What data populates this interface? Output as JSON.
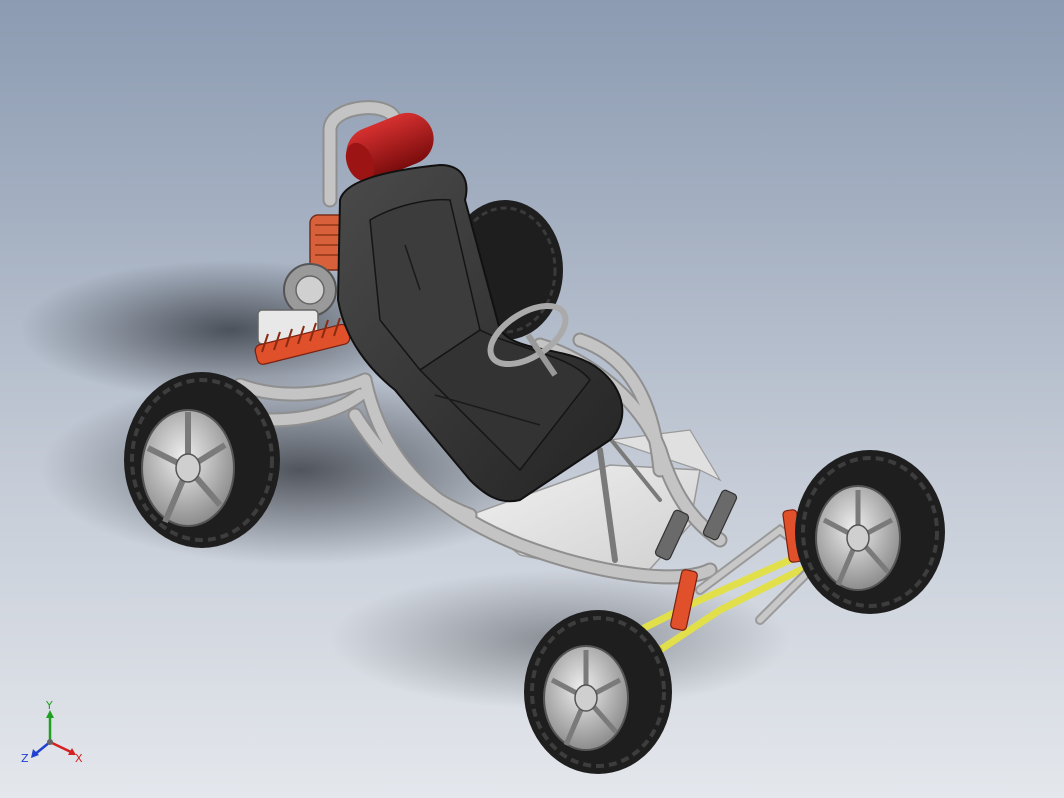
{
  "viewport": {
    "background_top": "#8c9bb2",
    "background_bottom": "#e4e7ec"
  },
  "model": {
    "subject": "go-kart-assembly",
    "colors": {
      "frame": "#c4c4c4",
      "frame_shadow": "#8f8f8f",
      "seat": "#2f2f2f",
      "seat_highlight": "#4a4a4a",
      "tire": "#1e1e1e",
      "rim": "#bdbdbd",
      "headrest": "#b01818",
      "shock_spring": "#e0502a",
      "a_arm": "#e2e04a",
      "floor_pan": "#e6e6e6",
      "engine": "#d8603a"
    }
  },
  "triad": {
    "x_label": "X",
    "y_label": "Y",
    "z_label": "Z",
    "x_color": "#d42020",
    "y_color": "#20a020",
    "z_color": "#2040d0"
  }
}
